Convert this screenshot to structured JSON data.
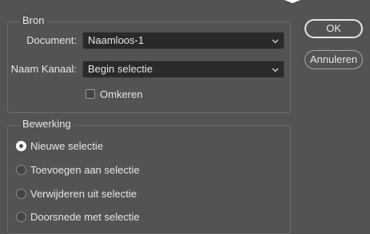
{
  "bron": {
    "title": "Bron",
    "document_label": "Document:",
    "document_value": "Naamloos-1",
    "kanaal_label": "Naam Kanaal:",
    "kanaal_value": "Begin selectie",
    "omkeren_label": "Omkeren"
  },
  "bewerking": {
    "title": "Bewerking",
    "options": [
      {
        "label": "Nieuwe selectie",
        "checked": true
      },
      {
        "label": "Toevoegen aan selectie",
        "checked": false
      },
      {
        "label": "Verwijderen uit selectie",
        "checked": false
      },
      {
        "label": "Doorsnede met selectie",
        "checked": false
      }
    ]
  },
  "buttons": {
    "ok": "OK",
    "cancel": "Annuleren"
  },
  "colors": {
    "background": "#535353",
    "field": "#2a2a2a",
    "text": "#e6e6e6"
  }
}
